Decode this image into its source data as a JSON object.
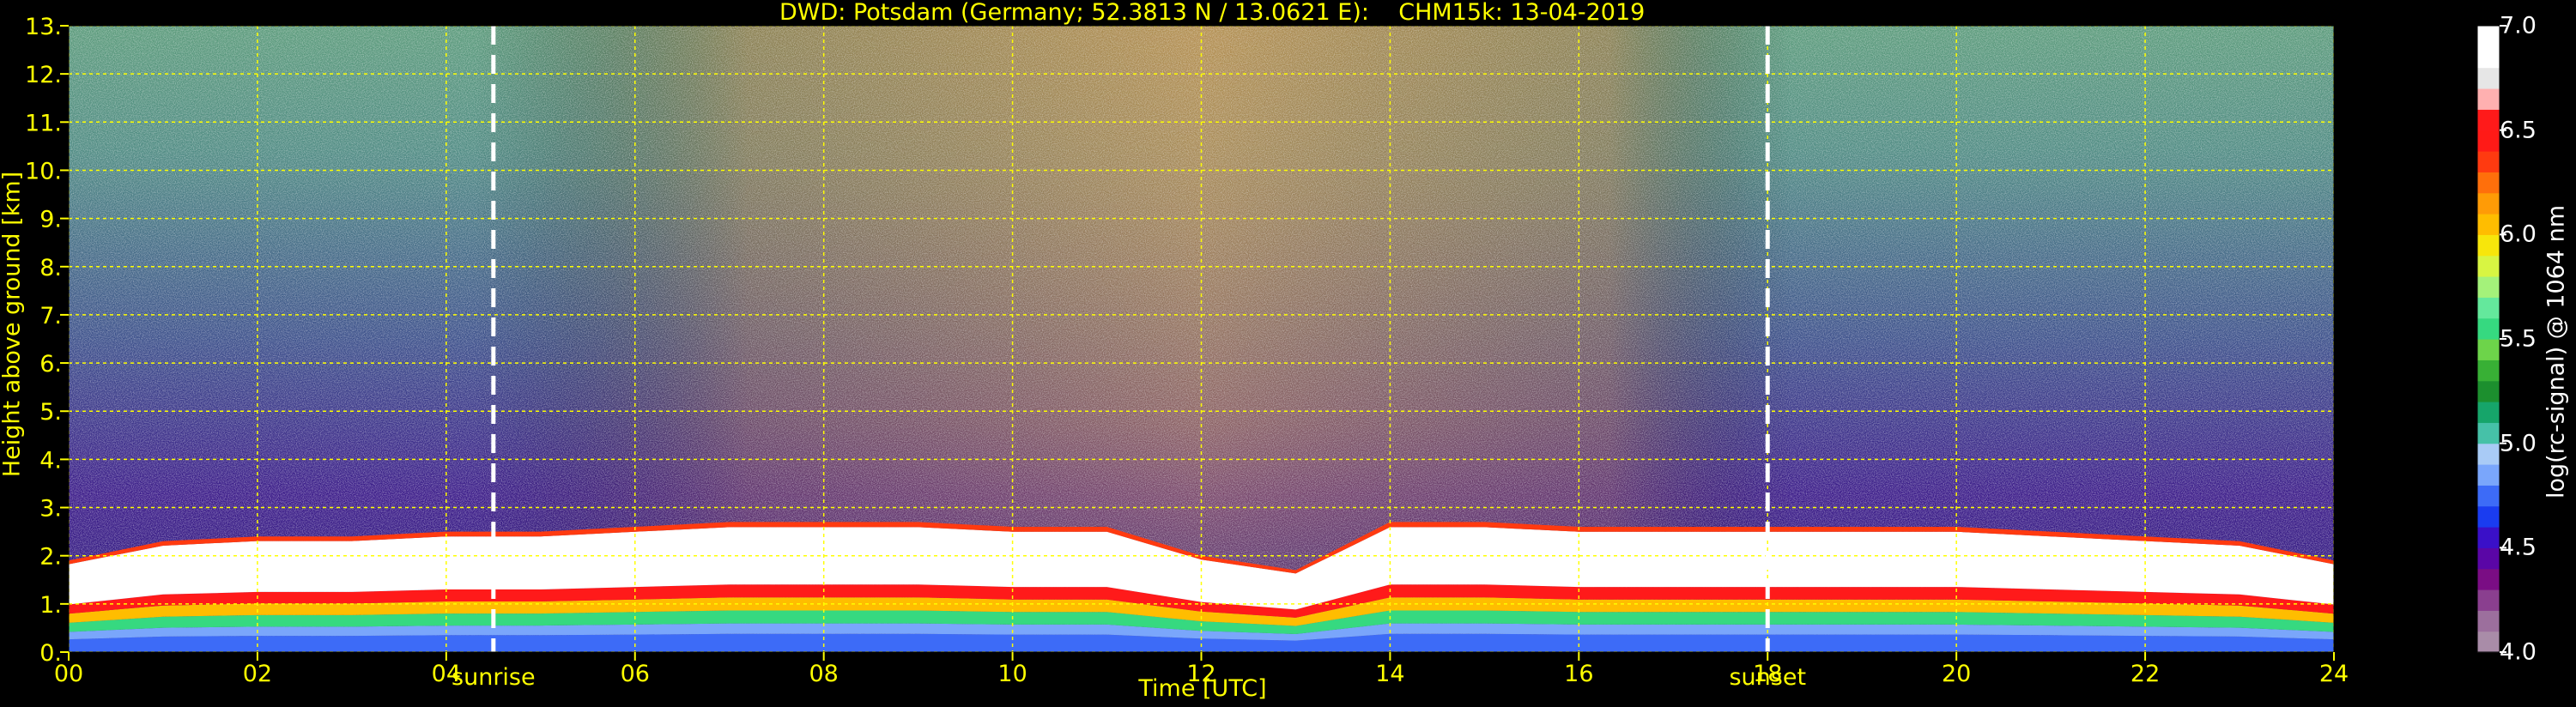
{
  "chart_data": {
    "type": "heatmap",
    "title": "DWD: Potsdam (Germany; 52.3813 N / 13.0621 E):    CHM15k: 13-04-2019",
    "xlabel": "Time [UTC]",
    "ylabel": "Height above ground [km]",
    "colorbar_label": "log(rc-signal) @ 1064 nm",
    "xlim": [
      0,
      24
    ],
    "ylim": [
      0,
      13
    ],
    "x_ticks": [
      "00",
      "02",
      "04",
      "06",
      "08",
      "10",
      "12",
      "14",
      "16",
      "18",
      "20",
      "22",
      "24"
    ],
    "y_ticks": [
      "0.",
      "1.",
      "2.",
      "3.",
      "4.",
      "5.",
      "6.",
      "7.",
      "8.",
      "9.",
      "10.",
      "11.",
      "12.",
      "13."
    ],
    "colorbar_range": [
      4.0,
      7.0
    ],
    "colorbar_ticks": [
      "4.0",
      "4.5",
      "5.0",
      "5.5",
      "6.0",
      "6.5",
      "7.0"
    ],
    "colorbar_colors": [
      "#a98ca8",
      "#9c6f9d",
      "#8a3f8f",
      "#7a0d84",
      "#5a06a6",
      "#3a10c8",
      "#1a3cf0",
      "#3d6bf7",
      "#7aa6fb",
      "#a9cbf6",
      "#46c1a8",
      "#16a56a",
      "#1c8f2e",
      "#38b035",
      "#6dd44a",
      "#36d980",
      "#64e89c",
      "#a4f27a",
      "#d8f542",
      "#f7e60b",
      "#ffbd00",
      "#ff9b06",
      "#ff6f0b",
      "#ff3a10",
      "#ff1a17",
      "#ff1a1a",
      "#ffb0b0",
      "#e6e6e6",
      "#ffffff",
      "#ffffff"
    ],
    "grid": true,
    "grid_color": "#ffff00",
    "annotations": [
      {
        "text": "sunrise",
        "x": 4.5
      },
      {
        "text": "sunset",
        "x": 18.0
      }
    ],
    "boundary_layer_top_km": {
      "hours": [
        0,
        1,
        2,
        3,
        4,
        5,
        6,
        7,
        8,
        9,
        10,
        11,
        12,
        13,
        14,
        15,
        16,
        17,
        18,
        19,
        20,
        21,
        22,
        23,
        24
      ],
      "values": [
        1.9,
        2.3,
        2.4,
        2.4,
        2.5,
        2.5,
        2.6,
        2.7,
        2.7,
        2.7,
        2.6,
        2.6,
        2.0,
        1.7,
        2.7,
        2.7,
        2.6,
        2.6,
        2.6,
        2.6,
        2.6,
        2.5,
        2.4,
        2.3,
        1.9
      ]
    }
  },
  "colors": {
    "background": "#000000",
    "axis_text": "#ffff00",
    "colorbar_text": "#ffffff",
    "annotation_line": "#ffffff"
  }
}
